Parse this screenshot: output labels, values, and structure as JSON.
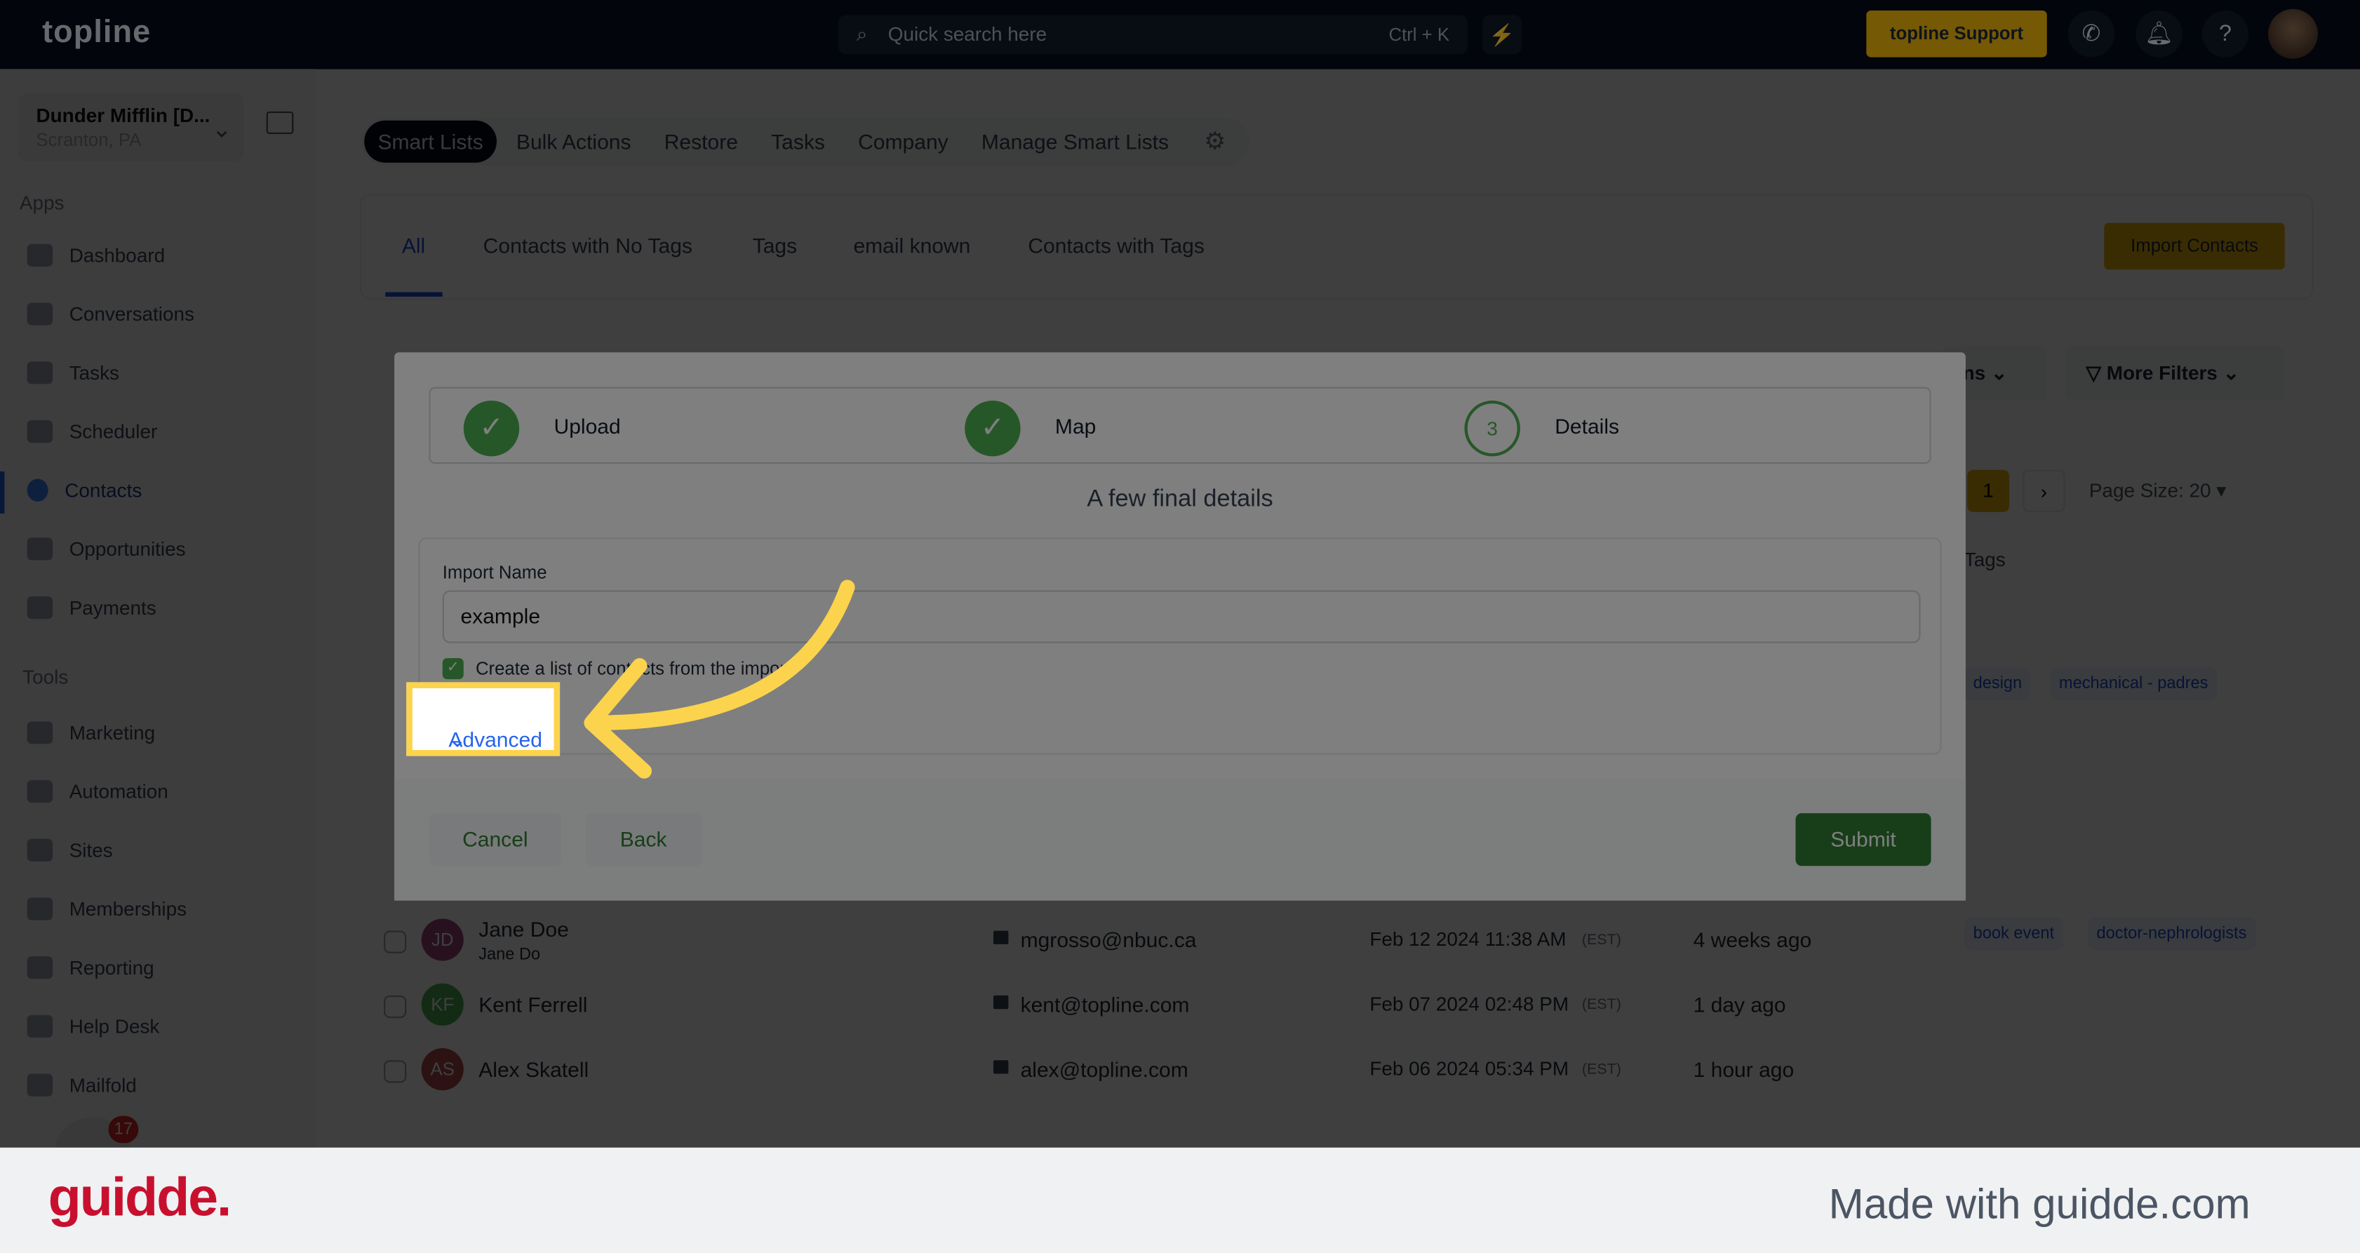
{
  "topbar": {
    "logo": "topline",
    "search_placeholder": "Quick search here",
    "search_shortcut": "Ctrl + K",
    "support_label": "topline Support"
  },
  "sidebar": {
    "account_name": "Dunder Mifflin [D...",
    "account_location": "Scranton, PA",
    "apps_heading": "Apps",
    "tools_heading": "Tools",
    "apps": [
      {
        "label": "Dashboard"
      },
      {
        "label": "Conversations"
      },
      {
        "label": "Tasks"
      },
      {
        "label": "Scheduler"
      },
      {
        "label": "Contacts",
        "active": true
      },
      {
        "label": "Opportunities"
      },
      {
        "label": "Payments"
      }
    ],
    "tools": [
      {
        "label": "Marketing"
      },
      {
        "label": "Automation"
      },
      {
        "label": "Sites"
      },
      {
        "label": "Memberships"
      },
      {
        "label": "Reporting"
      },
      {
        "label": "Help Desk"
      },
      {
        "label": "Mailfold"
      }
    ],
    "chat_badge": "17"
  },
  "main": {
    "top_tabs": [
      "Smart Lists",
      "Bulk Actions",
      "Restore",
      "Tasks",
      "Company",
      "Manage Smart Lists"
    ],
    "list_tabs": [
      "All",
      "Contacts with No Tags",
      "Tags",
      "email known",
      "Contacts with Tags"
    ],
    "import_label": "Import Contacts",
    "columns_partial": "ns",
    "more_filters": "More Filters",
    "current_page": "1",
    "page_size": "Page Size: 20",
    "tags_header": "Tags",
    "earlier_tags": [
      "design",
      "mechanical - padres"
    ],
    "rows": [
      {
        "initials": "JD",
        "name": "Jane Doe",
        "subname": "Jane Do",
        "email": "mgrosso@nbuc.ca",
        "date": "Feb 12 2024 11:38 AM",
        "tz": "(EST)",
        "activity": "4 weeks ago",
        "tags": [
          "book event",
          "doctor-nephrologists"
        ],
        "color": "#a0457a"
      },
      {
        "initials": "KF",
        "name": "Kent Ferrell",
        "subname": "",
        "email": "kent@topline.com",
        "date": "Feb 07 2024 02:48 PM",
        "tz": "(EST)",
        "activity": "1 day ago",
        "tags": [],
        "color": "#4caf50"
      },
      {
        "initials": "AS",
        "name": "Alex Skatell",
        "subname": "",
        "email": "alex@topline.com",
        "date": "Feb 06 2024 05:34 PM",
        "tz": "(EST)",
        "activity": "1 hour ago",
        "tags": [],
        "color": "#b04a4a"
      }
    ]
  },
  "modal": {
    "steps": [
      {
        "label": "Upload",
        "state": "done"
      },
      {
        "label": "Map",
        "state": "done"
      },
      {
        "label": "Details",
        "number": "3",
        "state": "current"
      }
    ],
    "heading": "A few final details",
    "import_name_label": "Import Name",
    "import_name_value": "example",
    "create_list_label": "Create a list of contacts from the import",
    "create_list_checked": true,
    "advanced_label": "Advanced",
    "cancel_label": "Cancel",
    "back_label": "Back",
    "submit_label": "Submit"
  },
  "footer": {
    "logo": "guidde.",
    "made_with": "Made with guidde.com"
  },
  "colors": {
    "accent": "#eab308",
    "success": "#2e7d32",
    "link": "#2563eb",
    "highlight": "#fcd34d",
    "brand_red": "#c8102e"
  }
}
